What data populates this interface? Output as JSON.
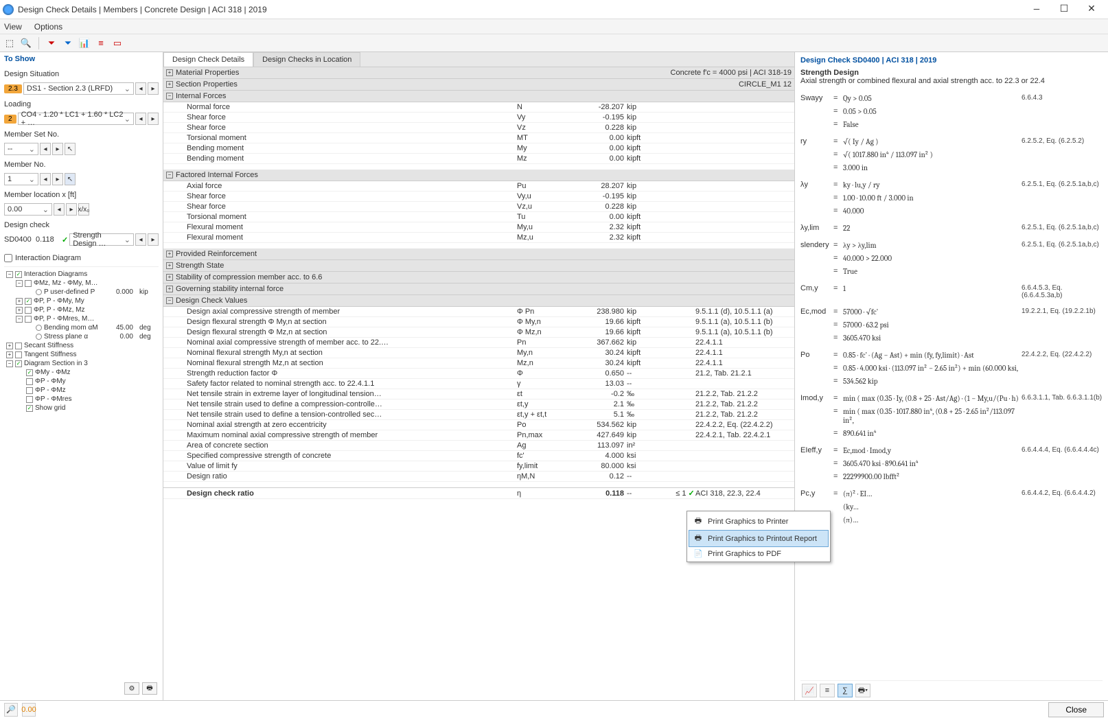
{
  "window": {
    "title": "Design Check Details | Members | Concrete Design | ACI 318 | 2019"
  },
  "menu": {
    "view": "View",
    "options": "Options"
  },
  "left": {
    "to_show": "To Show",
    "design_situation": "Design Situation",
    "ds_badge": "2.3",
    "ds_value": "DS1 - Section 2.3 (LRFD)",
    "loading": "Loading",
    "loading_badge": "2",
    "loading_value": "CO4 - 1.20 * LC1 + 1.60 * LC2 + …",
    "member_set": "Member Set No.",
    "member_set_value": "--",
    "member_no": "Member No.",
    "member_no_value": "1",
    "member_loc": "Member location x [ft]",
    "member_loc_value": "0.00",
    "member_loc_btn": "x/x₀",
    "design_check": "Design check",
    "dc_code": "SD0400",
    "dc_ratio": "0.118",
    "dc_desc": "Strength Design …",
    "interaction_diagram": "Interaction Diagram",
    "tree": [
      {
        "l": 0,
        "t": "⊟",
        "c": "✓",
        "lbl": "Interaction Diagrams"
      },
      {
        "l": 1,
        "t": "⊟",
        "c": "",
        "lbl": "ΦMz, Mz - ΦMy, M…"
      },
      {
        "l": 2,
        "t": "",
        "c": "",
        "r": true,
        "lbl": "P user-defined   P",
        "v": "0.000",
        "u": "kip"
      },
      {
        "l": 1,
        "t": "⊞",
        "c": "✓",
        "lbl": "ΦP, P - ΦMy, My"
      },
      {
        "l": 1,
        "t": "⊞",
        "c": "",
        "lbl": "ΦP, P - ΦMz, Mz"
      },
      {
        "l": 1,
        "t": "⊟",
        "c": "",
        "lbl": "ΦP, P - ΦMres, M…"
      },
      {
        "l": 2,
        "t": "",
        "c": "",
        "r": true,
        "lbl": "Bending mom αM",
        "v": "45.00",
        "u": "deg"
      },
      {
        "l": 2,
        "t": "",
        "c": "",
        "r": true,
        "lbl": "Stress plane α",
        "v": "0.00",
        "u": "deg"
      },
      {
        "l": 0,
        "t": "⊞",
        "c": "",
        "lbl": "Secant Stiffness"
      },
      {
        "l": 0,
        "t": "⊞",
        "c": "",
        "lbl": "Tangent Stiffness"
      },
      {
        "l": 0,
        "t": "⊟",
        "c": "✓",
        "lbl": "Diagram Section in 3"
      },
      {
        "l": 1,
        "t": "",
        "c": "✓",
        "lbl": "ΦMy - ΦMz"
      },
      {
        "l": 1,
        "t": "",
        "c": "",
        "lbl": "ΦP - ΦMy"
      },
      {
        "l": 1,
        "t": "",
        "c": "",
        "lbl": "ΦP - ΦMz"
      },
      {
        "l": 1,
        "t": "",
        "c": "",
        "lbl": "ΦP - ΦMres"
      },
      {
        "l": 1,
        "t": "",
        "c": "✓",
        "lbl": "Show grid"
      }
    ]
  },
  "tabs": {
    "t1": "Design Check Details",
    "t2": "Design Checks in Location"
  },
  "sections": [
    {
      "type": "hdr",
      "exp": "⊞",
      "lbl": "Material Properties",
      "rtxt": "Concrete f'c = 4000 psi | ACI 318-19"
    },
    {
      "type": "hdr",
      "exp": "⊞",
      "lbl": "Section Properties",
      "rtxt": "CIRCLE_M1 12"
    },
    {
      "type": "hdr",
      "exp": "⊟",
      "lbl": "Internal Forces"
    },
    {
      "type": "row",
      "lbl": "Normal force",
      "sym": "N",
      "val": "-28.207",
      "unit": "kip"
    },
    {
      "type": "row",
      "lbl": "Shear force",
      "sym": "Vy",
      "val": "-0.195",
      "unit": "kip"
    },
    {
      "type": "row",
      "lbl": "Shear force",
      "sym": "Vz",
      "val": "0.228",
      "unit": "kip"
    },
    {
      "type": "row",
      "lbl": "Torsional moment",
      "sym": "MT",
      "val": "0.00",
      "unit": "kipft"
    },
    {
      "type": "row",
      "lbl": "Bending moment",
      "sym": "My",
      "val": "0.00",
      "unit": "kipft"
    },
    {
      "type": "row",
      "lbl": "Bending moment",
      "sym": "Mz",
      "val": "0.00",
      "unit": "kipft"
    },
    {
      "type": "sp"
    },
    {
      "type": "hdr",
      "exp": "⊟",
      "lbl": "Factored Internal Forces"
    },
    {
      "type": "row",
      "lbl": "Axial force",
      "sym": "Pu",
      "val": "28.207",
      "unit": "kip"
    },
    {
      "type": "row",
      "lbl": "Shear force",
      "sym": "Vy,u",
      "val": "-0.195",
      "unit": "kip"
    },
    {
      "type": "row",
      "lbl": "Shear force",
      "sym": "Vz,u",
      "val": "0.228",
      "unit": "kip"
    },
    {
      "type": "row",
      "lbl": "Torsional moment",
      "sym": "Tu",
      "val": "0.00",
      "unit": "kipft"
    },
    {
      "type": "row",
      "lbl": "Flexural moment",
      "sym": "My,u",
      "val": "2.32",
      "unit": "kipft"
    },
    {
      "type": "row",
      "lbl": "Flexural moment",
      "sym": "Mz,u",
      "val": "2.32",
      "unit": "kipft"
    },
    {
      "type": "sp"
    },
    {
      "type": "hdr",
      "exp": "⊞",
      "lbl": "Provided Reinforcement"
    },
    {
      "type": "hdr",
      "exp": "⊞",
      "lbl": "Strength State"
    },
    {
      "type": "hdr",
      "exp": "⊞",
      "lbl": "Stability of compression member acc. to 6.6"
    },
    {
      "type": "hdr",
      "exp": "⊞",
      "lbl": "Governing stability internal force"
    },
    {
      "type": "hdr",
      "exp": "⊟",
      "lbl": "Design Check Values"
    },
    {
      "type": "row",
      "lbl": "Design axial compressive strength of member",
      "sym": "Φ Pn",
      "val": "238.980",
      "unit": "kip",
      "ref": "9.5.1.1 (d), 10.5.1.1 (a)"
    },
    {
      "type": "row",
      "lbl": "Design flexural strength Φ My,n at section",
      "sym": "Φ My,n",
      "val": "19.66",
      "unit": "kipft",
      "ref": "9.5.1.1 (a), 10.5.1.1 (b)"
    },
    {
      "type": "row",
      "lbl": "Design flexural strength Φ Mz,n at section",
      "sym": "Φ Mz,n",
      "val": "19.66",
      "unit": "kipft",
      "ref": "9.5.1.1 (a), 10.5.1.1 (b)"
    },
    {
      "type": "row",
      "lbl": "Nominal axial compressive strength of member acc. to 22.…",
      "sym": "Pn",
      "val": "367.662",
      "unit": "kip",
      "ref": "22.4.1.1"
    },
    {
      "type": "row",
      "lbl": "Nominal flexural strength My,n at section",
      "sym": "My,n",
      "val": "30.24",
      "unit": "kipft",
      "ref": "22.4.1.1"
    },
    {
      "type": "row",
      "lbl": "Nominal flexural strength Mz,n at section",
      "sym": "Mz,n",
      "val": "30.24",
      "unit": "kipft",
      "ref": "22.4.1.1"
    },
    {
      "type": "row",
      "lbl": "Strength reduction factor Φ",
      "sym": "Φ",
      "val": "0.650",
      "unit": "--",
      "ref": "21.2, Tab. 21.2.1"
    },
    {
      "type": "row",
      "lbl": "Safety factor related to nominal strength acc. to 22.4.1.1",
      "sym": "γ",
      "val": "13.03",
      "unit": "--"
    },
    {
      "type": "row",
      "lbl": "Net tensile strain in extreme layer of longitudinal tension…",
      "sym": "εt",
      "val": "-0.2",
      "unit": "‰",
      "ref": "21.2.2, Tab. 21.2.2"
    },
    {
      "type": "row",
      "lbl": "Net tensile strain used to define a compression-controlle…",
      "sym": "εt,y",
      "val": "2.1",
      "unit": "‰",
      "ref": "21.2.2, Tab. 21.2.2"
    },
    {
      "type": "row",
      "lbl": "Net tensile strain used to define a tension-controlled sec…",
      "sym": "εt,y + εt,t",
      "val": "5.1",
      "unit": "‰",
      "ref": "21.2.2, Tab. 21.2.2"
    },
    {
      "type": "row",
      "lbl": "Nominal axial strength at zero eccentricity",
      "sym": "Po",
      "val": "534.562",
      "unit": "kip",
      "ref": "22.4.2.2, Eq. (22.4.2.2)"
    },
    {
      "type": "row",
      "lbl": "Maximum nominal axial compressive strength of member",
      "sym": "Pn,max",
      "val": "427.649",
      "unit": "kip",
      "ref": "22.4.2.1, Tab. 22.4.2.1"
    },
    {
      "type": "row",
      "lbl": "Area of concrete section",
      "sym": "Ag",
      "val": "113.097",
      "unit": "in²"
    },
    {
      "type": "row",
      "lbl": "Specified compressive strength of concrete",
      "sym": "fc'",
      "val": "4.000",
      "unit": "ksi"
    },
    {
      "type": "row",
      "lbl": "Value of limit fy",
      "sym": "fy,limit",
      "val": "80.000",
      "unit": "ksi"
    },
    {
      "type": "row",
      "lbl": "Design ratio",
      "sym": "ηM,N",
      "val": "0.12",
      "unit": "--"
    },
    {
      "type": "sp"
    },
    {
      "type": "last",
      "lbl": "Design check ratio",
      "sym": "η",
      "val": "0.118",
      "unit": "--",
      "lim": "≤ 1",
      "chk": "✓",
      "ref": "ACI 318, 22.3, 22.4"
    }
  ],
  "right": {
    "title": "Design Check SD0400 | ACI 318 | 2019",
    "sub": "Strength Design",
    "desc": "Axial strength or combined flexural and axial strength acc. to 22.3 or 22.4",
    "eqs": [
      {
        "l": "Swayy",
        "e": "=",
        "x": "Qy  >  0.05",
        "r": "6.6.4.3"
      },
      {
        "l": "",
        "e": "=",
        "x": "0.05  >  0.05"
      },
      {
        "l": "",
        "e": "=",
        "x": "False"
      },
      {
        "sp": true
      },
      {
        "l": "ry",
        "e": "=",
        "x": "√( Iy / Ag )",
        "r": "6.2.5.2, Eq. (6.2.5.2)"
      },
      {
        "l": "",
        "e": "=",
        "x": "√( 1017.880 in⁴ / 113.097 in² )"
      },
      {
        "l": "",
        "e": "=",
        "x": "3.000 in"
      },
      {
        "sp": true
      },
      {
        "l": "λy",
        "e": "=",
        "x": "ky · lu,y / ry",
        "r": "6.2.5.1, Eq. (6.2.5.1a,b,c)"
      },
      {
        "l": "",
        "e": "=",
        "x": "1.00 · 10.00 ft / 3.000 in"
      },
      {
        "l": "",
        "e": "=",
        "x": "40.000"
      },
      {
        "sp": true
      },
      {
        "l": "λy,lim",
        "e": "=",
        "x": "22",
        "r": "6.2.5.1, Eq. (6.2.5.1a,b,c)"
      },
      {
        "sp": true
      },
      {
        "l": "slendery",
        "e": "=",
        "x": "λy  >  λy,lim",
        "r": "6.2.5.1, Eq. (6.2.5.1a,b,c)"
      },
      {
        "l": "",
        "e": "=",
        "x": "40.000  >  22.000"
      },
      {
        "l": "",
        "e": "=",
        "x": "True"
      },
      {
        "sp": true
      },
      {
        "l": "Cm,y",
        "e": "=",
        "x": "1",
        "r": "6.6.4.5.3, Eq. (6.6.4.5.3a,b)"
      },
      {
        "sp": true
      },
      {
        "l": "Ec,mod",
        "e": "=",
        "x": "57000 · √fc'",
        "r": "19.2.2.1, Eq. (19.2.2.1b)"
      },
      {
        "l": "",
        "e": "=",
        "x": "57000 · 63.2 psi"
      },
      {
        "l": "",
        "e": "=",
        "x": "3605.470 ksi"
      },
      {
        "sp": true
      },
      {
        "l": "Po",
        "e": "=",
        "x": "0.85 · fc' · (Ag − Ast) + min (fy, fy,limit) · Ast",
        "r": "22.4.2.2, Eq. (22.4.2.2)"
      },
      {
        "l": "",
        "e": "=",
        "x": "0.85 · 4.000 ksi · (113.097 in² − 2.65 in²) + min (60.000 ksi,"
      },
      {
        "l": "",
        "e": "=",
        "x": "534.562 kip"
      },
      {
        "sp": true
      },
      {
        "l": "Imod,y",
        "e": "=",
        "x": "min ( max (0.35 · Iy, (0.8 + 25 · Ast/Ag) · (1 − My,u/(Pu · h)",
        "r": "6.6.3.1.1, Tab. 6.6.3.1.1(b)"
      },
      {
        "l": "",
        "e": "=",
        "x": "min ( max (0.35 · 1017.880 in⁴, (0.8 + 25 · 2.65 in²/113.097 in²,"
      },
      {
        "l": "",
        "e": "=",
        "x": "890.641 in⁴"
      },
      {
        "sp": true
      },
      {
        "l": "EIeff,y",
        "e": "=",
        "x": "Ec,mod · Imod,y",
        "r": "6.6.4.4.4, Eq. (6.6.4.4.4c)"
      },
      {
        "l": "",
        "e": "=",
        "x": "3605.470 ksi · 890.641 in⁴"
      },
      {
        "l": "",
        "e": "=",
        "x": "22299900.00 lbfft²"
      },
      {
        "sp": true
      },
      {
        "l": "Pc,y",
        "e": "=",
        "x": "(π)² · EI…",
        "r": "6.6.4.4.2, Eq. (6.6.4.4.2)"
      },
      {
        "l": "",
        "e": "",
        "x": "(ky…"
      },
      {
        "l": "",
        "e": "",
        "x": "(π)…"
      }
    ]
  },
  "ctx": {
    "m1": "Print Graphics to Printer",
    "m2": "Print Graphics to Printout Report",
    "m3": "Print Graphics to PDF"
  },
  "close": "Close"
}
